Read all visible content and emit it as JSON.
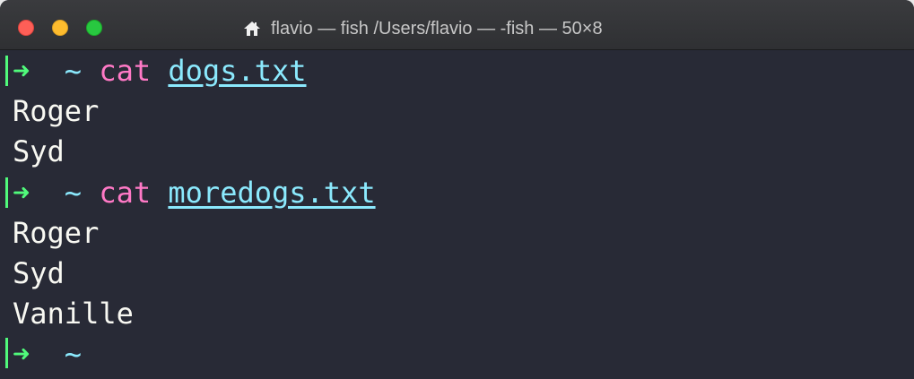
{
  "window": {
    "title": "flavio — fish /Users/flavio — -fish — 50×8",
    "icon": "home-icon"
  },
  "terminal": {
    "line1": {
      "arrow": "➜",
      "cwd": "~",
      "command": "cat",
      "arg": "dogs.txt"
    },
    "line2": "Roger",
    "line3": "Syd",
    "line4": {
      "arrow": "➜",
      "cwd": "~",
      "command": "cat",
      "arg": "moredogs.txt"
    },
    "line5": "Roger",
    "line6": "Syd",
    "line7": "Vanille",
    "line8": {
      "arrow": "➜",
      "cwd": "~"
    }
  },
  "colors": {
    "background": "#282a36",
    "prompt_arrow": "#50fa7b",
    "cwd": "#8be9fd",
    "command": "#ff79c6",
    "text": "#f8f8f2"
  }
}
